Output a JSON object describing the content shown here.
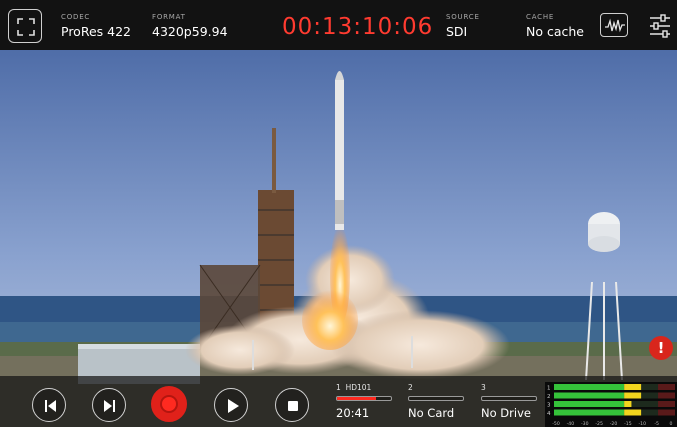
{
  "header": {
    "codec": {
      "label": "CODEC",
      "value": "ProRes 422"
    },
    "format": {
      "label": "FORMAT",
      "value": "4320p59.94"
    },
    "timecode": "00:13:10:06",
    "source": {
      "label": "SOURCE",
      "value": "SDI"
    },
    "cache": {
      "label": "CACHE",
      "value": "No cache"
    }
  },
  "transport": {
    "buttons": [
      "skip-previous",
      "skip-next",
      "record",
      "play",
      "stop"
    ]
  },
  "media_slots": [
    {
      "number": "1",
      "name": "HD101",
      "status": "20:41",
      "fill": 0.72
    },
    {
      "number": "2",
      "name": "",
      "status": "No Card",
      "fill": 0
    },
    {
      "number": "3",
      "name": "",
      "status": "No Drive",
      "fill": 0
    }
  ],
  "audio_meters": {
    "channels": [
      "1",
      "2",
      "3",
      "4"
    ],
    "scale": [
      "-50",
      "-40",
      "-30",
      "-25",
      "-20",
      "-15",
      "-10",
      "-5",
      "0"
    ],
    "levels": [
      0.72,
      0.72,
      0.64,
      0.72
    ],
    "colors": {
      "green": "#35c23a",
      "yellow": "#f2d51e",
      "red": "#e02020"
    }
  },
  "alert": {
    "symbol": "!"
  },
  "colors": {
    "timecode": "#ff3b30",
    "record": "#e0211a",
    "slot_fill": "#ff2a20"
  }
}
